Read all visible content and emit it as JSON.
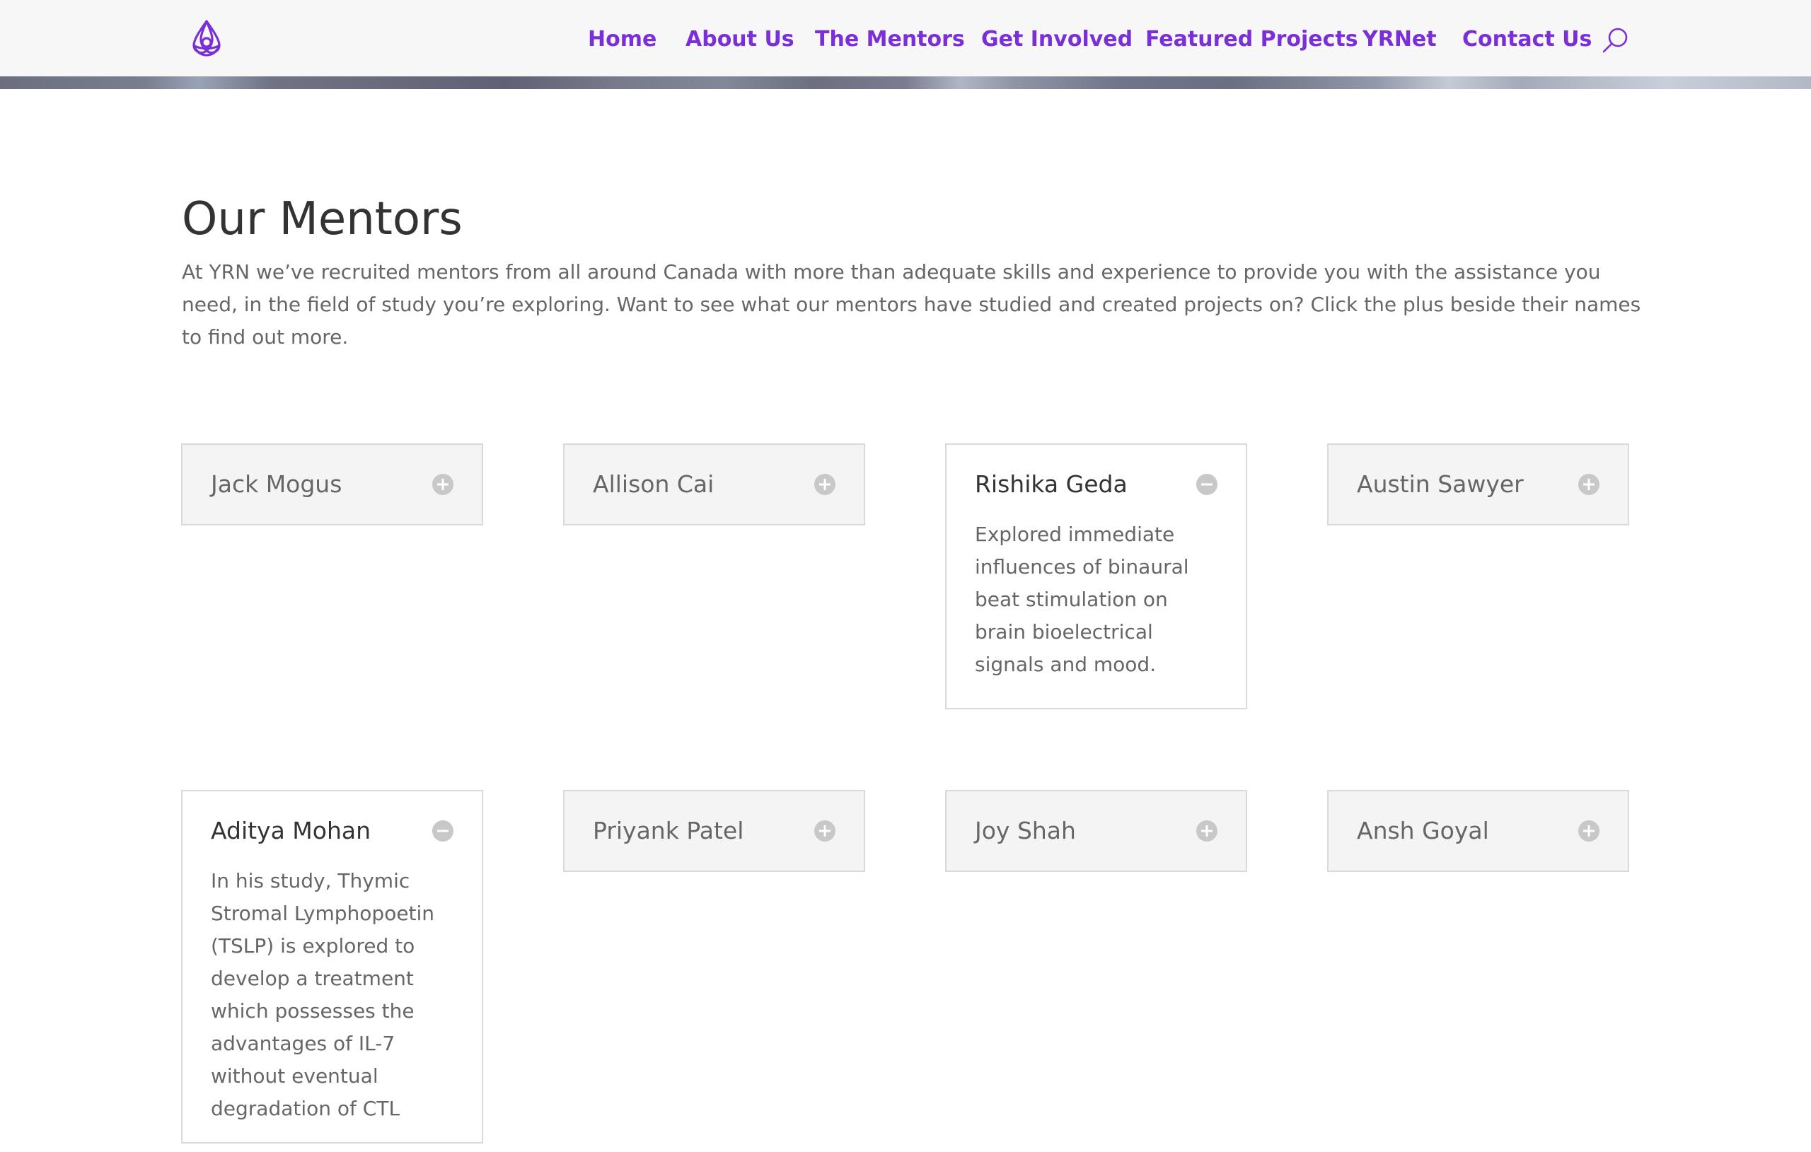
{
  "header": {
    "logo_icon": "yrn-trefoil-logo",
    "brand_color": "#7b2fd6",
    "nav": [
      {
        "label": "Home"
      },
      {
        "label": "About Us"
      },
      {
        "label": "The Mentors"
      },
      {
        "label": "Get Involved"
      },
      {
        "label": "Featured Projects"
      },
      {
        "label": "YRNet"
      },
      {
        "label": "Contact Us"
      }
    ],
    "search_icon": "search-icon"
  },
  "main": {
    "title": "Our Mentors",
    "intro": "At YRN we’ve recruited mentors from all around Canada with more than adequate skills and experience to provide you with the assistance you need, in the field of study you’re exploring. Want to see what our mentors have studied and created projects on? Click the plus beside their names to find out more.",
    "mentors": [
      {
        "name": "Jack Mogus",
        "state": "closed",
        "icon": "plus-circle-icon"
      },
      {
        "name": "Allison Cai",
        "state": "closed",
        "icon": "plus-circle-icon"
      },
      {
        "name": "Rishika Geda",
        "state": "open",
        "icon": "minus-circle-icon",
        "description": "Explored immediate influences of binaural beat stimulation on brain bioelectrical signals and mood."
      },
      {
        "name": "Austin Sawyer",
        "state": "closed",
        "icon": "plus-circle-icon"
      },
      {
        "name": "Aditya Mohan",
        "state": "open",
        "icon": "minus-circle-icon",
        "description": "In his study, Thymic Stromal Lymphopoetin (TSLP) is explored to develop a treatment which possesses the advantages of IL-7 without eventual degradation of CTL"
      },
      {
        "name": "Priyank Patel",
        "state": "closed",
        "icon": "plus-circle-icon"
      },
      {
        "name": "Joy Shah",
        "state": "closed",
        "icon": "plus-circle-icon"
      },
      {
        "name": "Ansh Goyal",
        "state": "closed",
        "icon": "plus-circle-icon"
      }
    ]
  }
}
